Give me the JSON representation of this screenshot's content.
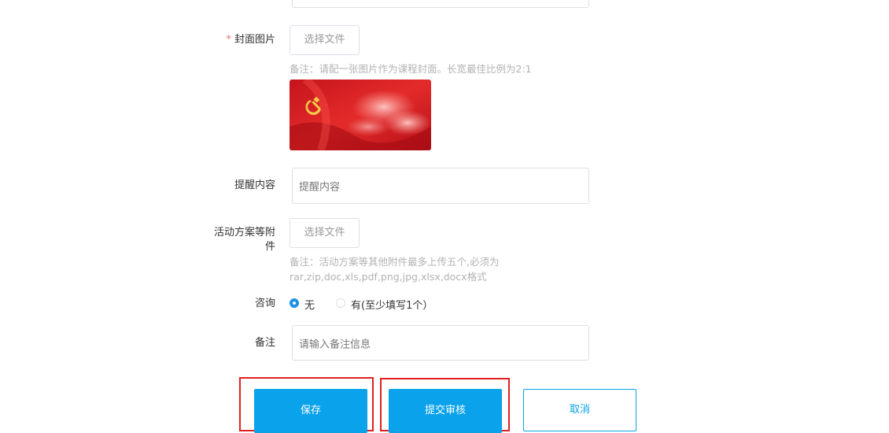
{
  "cover": {
    "label": "封面图片",
    "required_mark": "*",
    "button_label": "选择文件",
    "hint": "备注：请配一张图片作为课程封面。长宽最佳比例为2:1"
  },
  "reminder": {
    "label": "提醒内容",
    "placeholder": "提醒内容"
  },
  "attachment": {
    "label": "活动方案等附件",
    "button_label": "选择文件",
    "hint_line1": "备注：活动方案等其他附件最多上传五个,必须为",
    "hint_line2": "rar,zip,doc,xls,pdf,png,jpg,xlsx,docx格式"
  },
  "consult": {
    "label": "咨询",
    "options": [
      {
        "label": "无",
        "selected": true
      },
      {
        "label": "有(至少填写1个）",
        "selected": false
      }
    ]
  },
  "remark": {
    "label": "备注",
    "placeholder": "请输入备注信息"
  },
  "actions": {
    "save": "保存",
    "submit": "提交审核",
    "cancel": "取消"
  },
  "colors": {
    "primary": "#0aa2ea",
    "required": "#f56c6c",
    "highlight": "#e02020",
    "radio_selected": "#1e90e6"
  }
}
